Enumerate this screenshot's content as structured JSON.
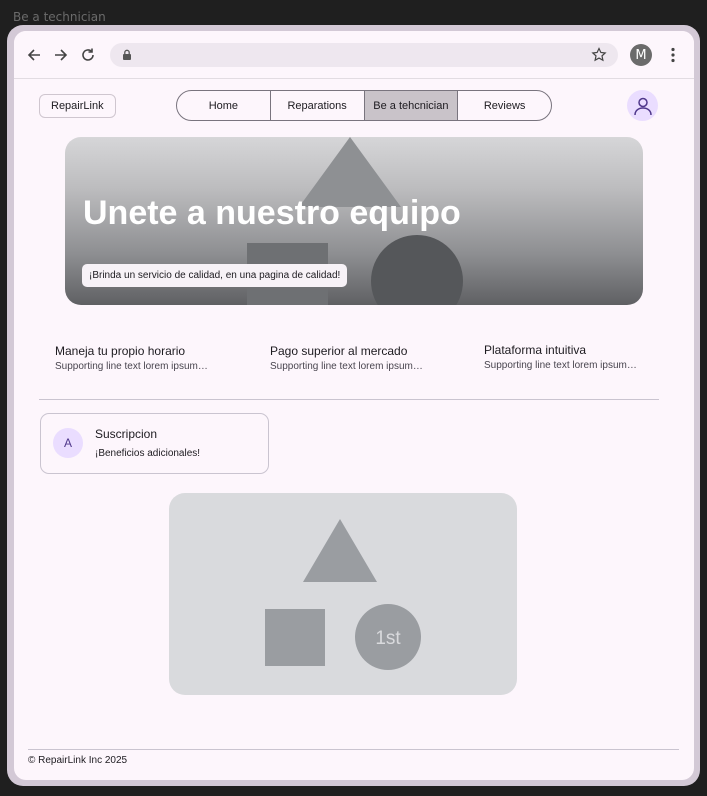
{
  "frame": {
    "title": "Be a technician"
  },
  "browser": {
    "profile_initial": "M",
    "icons": [
      "back-arrow-icon",
      "forward-arrow-icon",
      "reload-icon",
      "lock-icon",
      "star-icon",
      "kebab-menu-icon"
    ]
  },
  "header": {
    "brand": "RepairLink",
    "nav": [
      "Home",
      "Reparations",
      "Be a tehcnician",
      "Reviews"
    ],
    "active_tab": "Be a tehcnician"
  },
  "hero": {
    "title": "Unete a nuestro equipo",
    "chip": "¡Brinda un servicio de calidad, en una pagina de calidad!"
  },
  "features": [
    {
      "title": "Maneja tu propio horario",
      "subtitle": "Supporting line text lorem ipsum…"
    },
    {
      "title": "Pago superior al mercado",
      "subtitle": "Supporting line text lorem ipsum…"
    },
    {
      "title": "Plataforma intuitiva",
      "subtitle": "Supporting line text lorem ipsum…"
    }
  ],
  "card": {
    "avatar": "A",
    "title": "Suscripcion",
    "subtitle": "¡Beneficios adicionales!"
  },
  "media": {
    "badge": "1st"
  },
  "footer": {
    "text": "© RepairLink Inc 2025"
  },
  "colors": {
    "accent_container": "#eaddff",
    "surface": "#fdf6fc",
    "active_tab": "#c9c3c9"
  }
}
